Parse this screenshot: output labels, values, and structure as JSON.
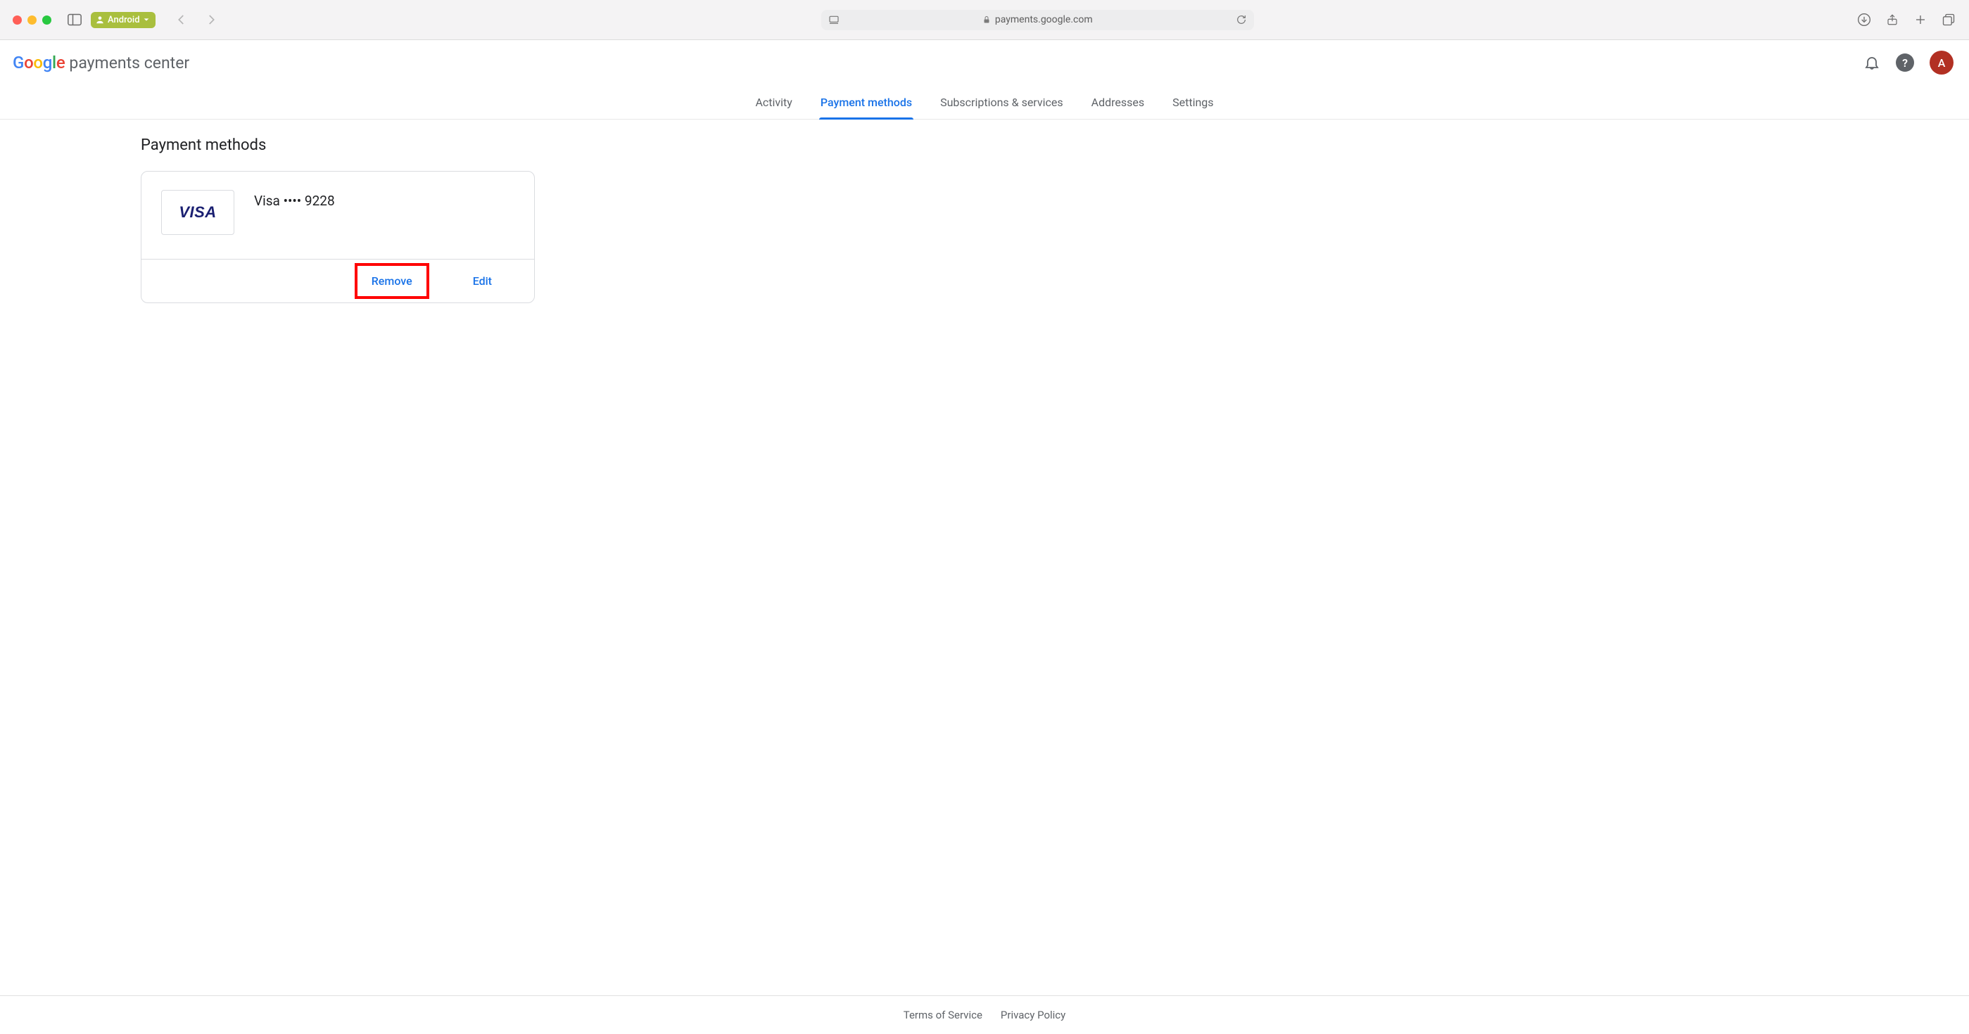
{
  "browser": {
    "profile_label": "Android",
    "url_display": "payments.google.com"
  },
  "header": {
    "logo_product": "payments center",
    "avatar_initial": "A"
  },
  "tabs": [
    {
      "label": "Activity",
      "active": false
    },
    {
      "label": "Payment methods",
      "active": true
    },
    {
      "label": "Subscriptions & services",
      "active": false
    },
    {
      "label": "Addresses",
      "active": false
    },
    {
      "label": "Settings",
      "active": false
    }
  ],
  "page": {
    "title": "Payment methods",
    "card": {
      "brand": "VISA",
      "label": "Visa •••• 9228",
      "remove_label": "Remove",
      "edit_label": "Edit"
    }
  },
  "footer": {
    "terms": "Terms of Service",
    "privacy": "Privacy Policy"
  }
}
